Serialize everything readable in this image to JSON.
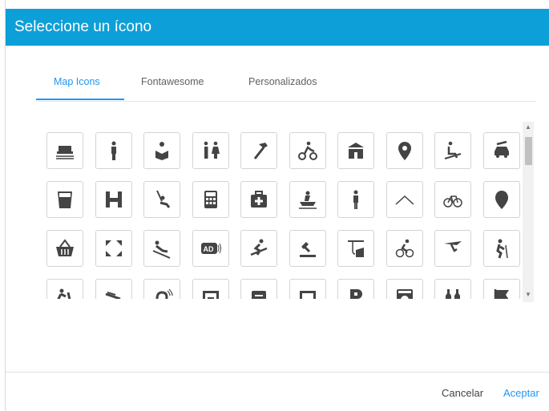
{
  "dialog": {
    "title": "Seleccione un ícono",
    "accent_color": "#0d9fd8",
    "tab_active_color": "#2196f3"
  },
  "tabs": [
    {
      "label": "Map Icons",
      "active": true
    },
    {
      "label": "Fontawesome",
      "active": false
    },
    {
      "label": "Personalizados",
      "active": false
    }
  ],
  "icons": [
    "ferry-icon",
    "toilet-man-icon",
    "reading-icon",
    "restrooms-icon",
    "hammer-icon",
    "motocross-icon",
    "school-icon",
    "map-pin-icon",
    "ski-lift-icon",
    "car-repair-icon",
    "drink-icon",
    "hospital-icon",
    "swing-icon",
    "calculator-icon",
    "first-aid-icon",
    "rafting-icon",
    "man-icon",
    "roof-icon",
    "bicycle-icon",
    "marker-icon",
    "basket-icon",
    "fullscreen-icon",
    "sledding-icon",
    "audio-description-icon",
    "snowboarding-icon",
    "auction-icon",
    "fishing-icon",
    "cycling-icon",
    "hang-gliding-icon",
    "hiking-icon",
    "climbing-icon",
    "boat-ramp-icon",
    "hearing-icon",
    "picture-frame-icon",
    "storage-icon",
    "photo-icon",
    "parking-icon",
    "laundry-icon",
    "bottles-icon",
    "flag-icon"
  ],
  "footer": {
    "cancel_label": "Cancelar",
    "accept_label": "Aceptar"
  }
}
